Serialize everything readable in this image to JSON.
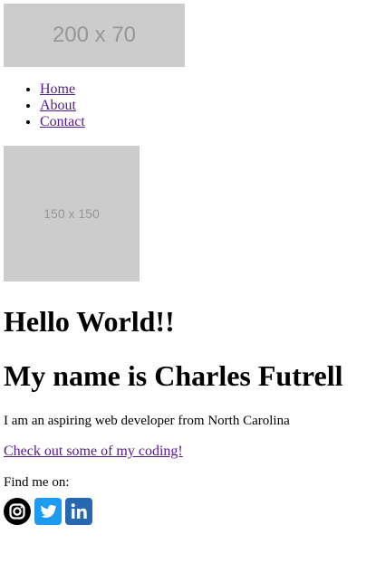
{
  "header": {
    "logo_placeholder_text": "200 x 70"
  },
  "nav": {
    "items": [
      {
        "label": "Home"
      },
      {
        "label": "About"
      },
      {
        "label": "Contact"
      }
    ]
  },
  "profile": {
    "placeholder_text": "150 x 150"
  },
  "main": {
    "heading1": "Hello World!!",
    "heading2": "My name is Charles Futrell",
    "intro": "I am an aspiring web developer from North Carolina",
    "coding_link": "Check out some of my coding!",
    "find_me": "Find me on:"
  },
  "socials": [
    {
      "name": "instagram-icon",
      "color": "#000000"
    },
    {
      "name": "twitter-icon",
      "color": "#1d9bf0"
    },
    {
      "name": "linkedin-icon",
      "color": "#2867b2"
    }
  ]
}
